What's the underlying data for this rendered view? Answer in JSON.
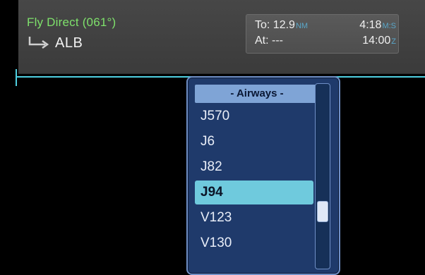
{
  "header": {
    "title": "Fly Direct (061°)",
    "destination": "ALB"
  },
  "data_box": {
    "to_label": "To:",
    "to_value": "12.9",
    "to_unit": "NM",
    "time_value": "4:18",
    "time_unit": "M:S",
    "at_label": "At:",
    "at_value": "---",
    "eta_value": "14:00",
    "eta_unit": "Z"
  },
  "dropdown": {
    "header": "- Airways -",
    "items": [
      "J570",
      "J6",
      "J82",
      "J94",
      "V123",
      "V130"
    ],
    "selected_index": 3
  },
  "colors": {
    "title_green": "#7ee06b",
    "accent_cyan": "#4fd0e1",
    "dropdown_bg": "#1f3a6b",
    "selected_bg": "#6fcadd"
  },
  "icons": {
    "route": "arrow-turn-right-icon"
  }
}
